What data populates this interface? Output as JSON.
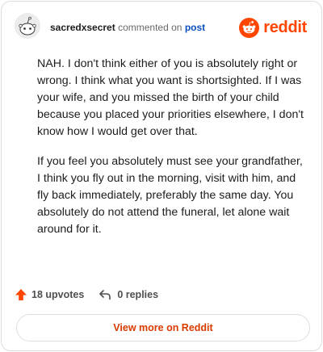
{
  "comment": {
    "username": "sacredxsecret",
    "action_text": "commented on",
    "post_link": "post",
    "paragraphs": [
      "NAH. I don't think either of you is absolutely right or wrong. I think what you want is shortsighted. If I was your wife, and you missed the birth of your child because you placed your priorities elsewhere, I don't know how I would get over that.",
      "If you feel you absolutely must see your grandfather, I think you fly out in the morning, visit with him, and fly back immediately, preferably the same day. You absolutely do not attend the funeral, let alone wait around for it."
    ]
  },
  "brand": {
    "wordmark": "reddit",
    "color": "#ff4500",
    "icon": "reddit-logo-icon"
  },
  "stats": {
    "upvotes": "18 upvotes",
    "replies": "0 replies",
    "upvote_icon": "upvote-arrow-icon",
    "reply_icon": "reply-arrow-icon",
    "upvote_color": "#ff4500"
  },
  "actions": {
    "view_more": "View more on Reddit",
    "view_more_color": "#d93a00"
  }
}
